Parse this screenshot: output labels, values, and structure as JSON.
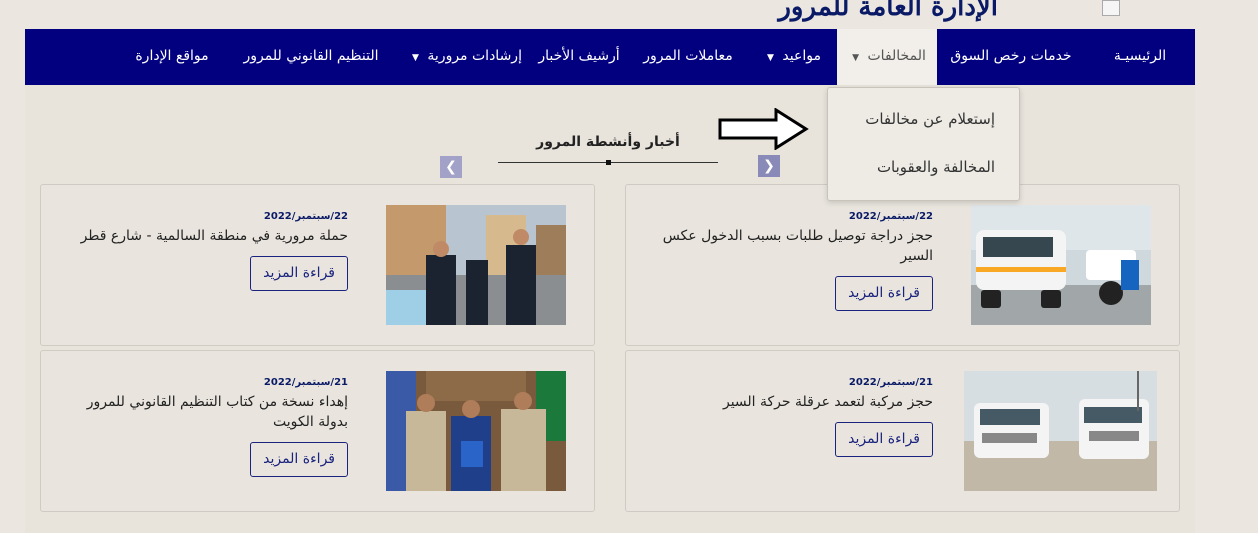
{
  "header": {
    "title": "الإدارة العامة للمرور"
  },
  "nav": {
    "items": [
      {
        "label": "الرئيسيـة",
        "has_caret": false,
        "active": false
      },
      {
        "label": "خدمات رخص السوق",
        "has_caret": false,
        "active": false
      },
      {
        "label": "المخالفات",
        "has_caret": true,
        "active": true
      },
      {
        "label": "مواعيد",
        "has_caret": true,
        "active": false
      },
      {
        "label": "معاملات المرور",
        "has_caret": false,
        "active": false
      },
      {
        "label": "أرشيف الأخبار",
        "has_caret": false,
        "active": false
      },
      {
        "label": "إرشادات مرورية",
        "has_caret": true,
        "active": false
      },
      {
        "label": "التنظيم القانوني للمرور",
        "has_caret": false,
        "active": false
      },
      {
        "label": "مواقع الإدارة",
        "has_caret": false,
        "active": false
      }
    ],
    "caret_glyph": "▼"
  },
  "dropdown": {
    "items": [
      {
        "label": "إستعلام عن مخالفات"
      },
      {
        "label": "المخالفة والعقوبات"
      }
    ]
  },
  "news": {
    "section_title": "أخبار وأنشطة المرور",
    "prev_icon": "chevron-left-icon",
    "next_icon": "chevron-right-icon",
    "read_more_label": "قراءة المزيد",
    "cards": [
      {
        "date": "22/سبتمبر/2022",
        "title": "حجز دراجة توصيل طلبات بسبب الدخول عكس السير"
      },
      {
        "date": "22/سبتمبر/2022",
        "title": "حملة مرورية في منطقة السالمية - شارع قطر"
      },
      {
        "date": "21/سبتمبر/2022",
        "title": "حجز مركبة لتعمد عرقلة حركة السير"
      },
      {
        "date": "21/سبتمبر/2022",
        "title": "إهداء نسخة من كتاب التنظيم القانوني للمرور بدولة الكويت"
      }
    ]
  },
  "colors": {
    "nav_bg": "#030080",
    "accent": "#1a237e",
    "background": "#ebe7e0"
  }
}
